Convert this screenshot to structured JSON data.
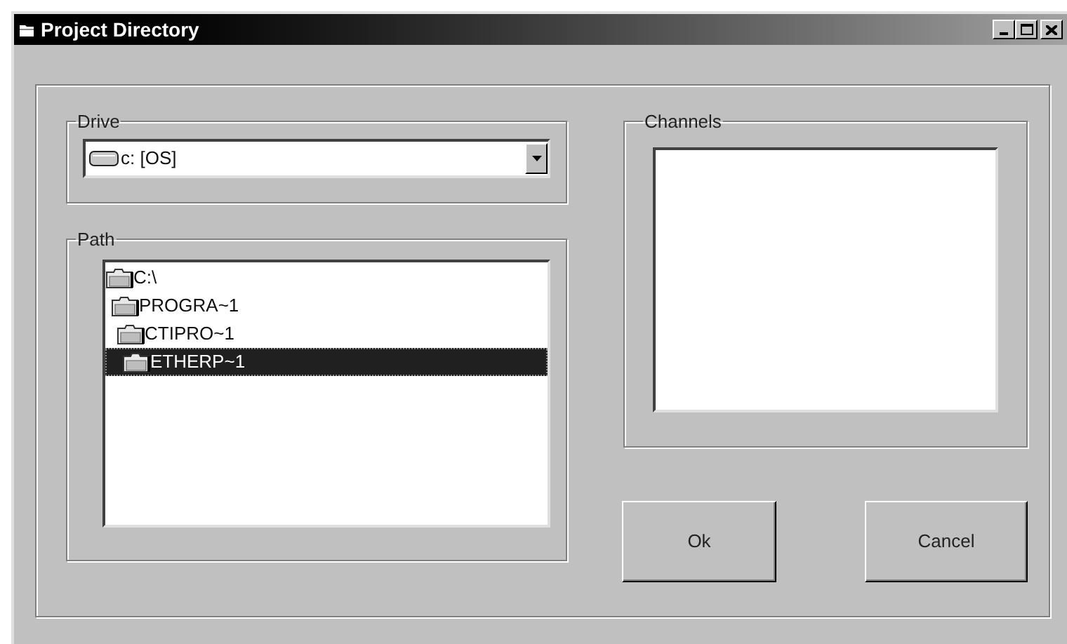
{
  "window": {
    "title": "Project Directory"
  },
  "drive": {
    "label": "Drive",
    "value": "c: [OS]"
  },
  "path": {
    "label": "Path",
    "tree": [
      {
        "label": "C:\\",
        "selected": false,
        "children": [
          {
            "label": "PROGRA~1",
            "selected": false,
            "children": [
              {
                "label": "CTIPRO~1",
                "selected": false,
                "children": [
                  {
                    "label": "ETHERP~1",
                    "selected": true
                  }
                ]
              }
            ]
          }
        ]
      }
    ]
  },
  "channels": {
    "label": "Channels"
  },
  "buttons": [
    {
      "label": "Ok"
    },
    {
      "label": "Cancel"
    }
  ]
}
